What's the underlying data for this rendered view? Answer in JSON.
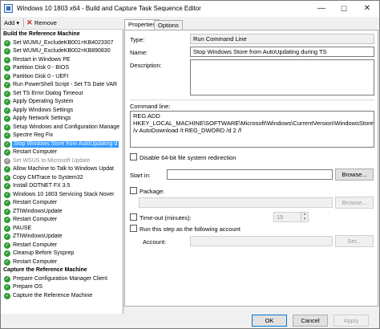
{
  "window": {
    "title": "Windows 10 1803 x64 - Build and Capture Task Sequence Editor"
  },
  "window_controls": {
    "minimize": "—",
    "maximize": "☐",
    "close": "✕"
  },
  "toolbar": {
    "add_label": "Add ▾",
    "remove_label": "Remove"
  },
  "tree": {
    "items": [
      {
        "type": "group",
        "label": "Build the Reference Machine"
      },
      {
        "type": "step",
        "label": "Set WUMU_ExcludeKB001=KB4023307"
      },
      {
        "type": "step",
        "label": "Set WUMU_ExcludeKB002=KB890830"
      },
      {
        "type": "step",
        "label": "Restart in Windows PE"
      },
      {
        "type": "step",
        "label": "Partition Disk 0 - BIOS"
      },
      {
        "type": "step",
        "label": "Partition Disk 0 - UEFI"
      },
      {
        "type": "step",
        "label": "Run PowerShell Script - Set TS Date VAR"
      },
      {
        "type": "step",
        "label": "Set TS Error Dialog Timeout"
      },
      {
        "type": "step",
        "label": "Apply Operating System"
      },
      {
        "type": "step",
        "label": "Apply Windows Settings"
      },
      {
        "type": "step",
        "label": "Apply Network Settings"
      },
      {
        "type": "step",
        "label": "Setup Windows and Configuration Manage"
      },
      {
        "type": "step",
        "label": "Spectre Reg Fix"
      },
      {
        "type": "step",
        "label": "Stop Windows Store from AutoUpdating d",
        "selected": true
      },
      {
        "type": "step",
        "label": "Restart Computer"
      },
      {
        "type": "step",
        "label": "Set WSUS to Microsoft Update",
        "disabled": true
      },
      {
        "type": "step",
        "label": "Allow Machine to Talk to Windows Updat"
      },
      {
        "type": "step",
        "label": "Copy CMTrace to System32"
      },
      {
        "type": "step",
        "label": "Install DOTNET FX 3.5"
      },
      {
        "type": "step",
        "label": "Windows 10 1803 Servicing Stack Nover"
      },
      {
        "type": "step",
        "label": "Restart Computer"
      },
      {
        "type": "step",
        "label": "ZTIWindowsUpdate"
      },
      {
        "type": "step",
        "label": "Restart Computer"
      },
      {
        "type": "step",
        "label": "PAUSE"
      },
      {
        "type": "step",
        "label": "ZTIWindowsUpdate"
      },
      {
        "type": "step",
        "label": "Restart Computer"
      },
      {
        "type": "step",
        "label": "Cleanup Before Sysprep"
      },
      {
        "type": "step",
        "label": "Restart Computer"
      },
      {
        "type": "group",
        "label": "Capture the Reference Machine"
      },
      {
        "type": "step",
        "label": "Prepare Configuration Manager Client"
      },
      {
        "type": "step",
        "label": "Prepare OS"
      },
      {
        "type": "step",
        "label": "Capture the Reference Machine"
      }
    ]
  },
  "tabs": {
    "properties": "Properties",
    "options": "Options"
  },
  "properties": {
    "type_label": "Type:",
    "type_value": "Run Command Line",
    "name_label": "Name:",
    "name_value": "Stop Windows Store from AutoUpdating during TS",
    "description_label": "Description:",
    "description_value": "",
    "command_line_label": "Command line:",
    "command_line_value": "REG ADD HKEY_LOCAL_MACHINE\\SOFTWARE\\Microsoft\\Windows\\CurrentVersion\\WindowsStore\\WindowsUpdate /v AutoDownload /t REG_DWORD /d 2 /f",
    "disable_redirection_label": "Disable 64-bit file system redirection",
    "start_in_label": "Start in:",
    "start_in_value": "",
    "browse_label": "Browse...",
    "package_label": "Package:",
    "package_value": "",
    "package_browse_label": "Browse...",
    "timeout_label": "Time-out (minutes):",
    "timeout_value": "15",
    "run_as_label": "Run this step as the following account",
    "account_label": "Account:",
    "account_value": "",
    "set_label": "Set..."
  },
  "bottom": {
    "ok_label": "OK",
    "cancel_label": "Cancel",
    "apply_label": "Apply"
  },
  "colors": {
    "accent": "#3399ff",
    "check_green": "#2e9b34"
  }
}
